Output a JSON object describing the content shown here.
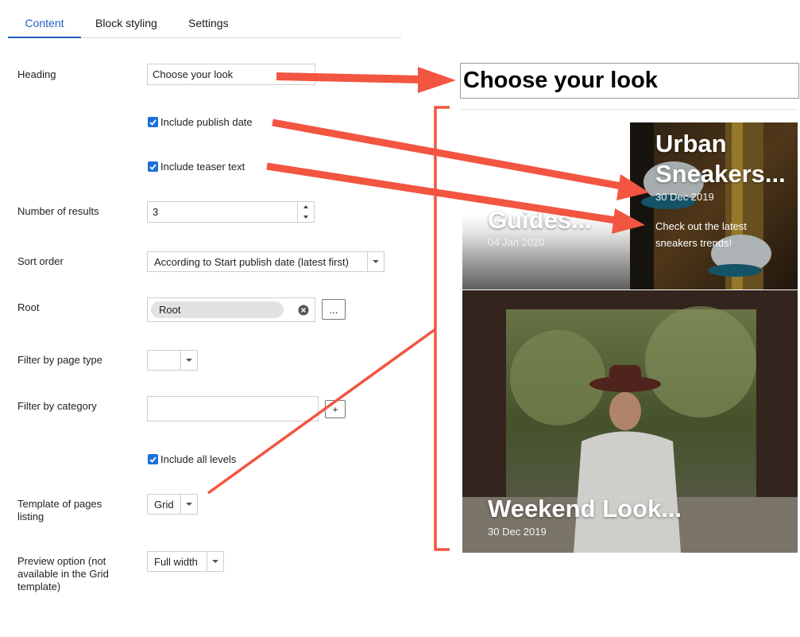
{
  "tabs": [
    "Content",
    "Block styling",
    "Settings"
  ],
  "form": {
    "heading_label": "Heading",
    "heading_value": "Choose your look",
    "include_publish_date": "Include publish date",
    "include_teaser_text": "Include teaser text",
    "number_of_results_label": "Number of results",
    "number_of_results_value": "3",
    "sort_order_label": "Sort order",
    "sort_order_value": "According to Start publish date (latest first)",
    "root_label": "Root",
    "root_value": "Root",
    "root_browse": "...",
    "filter_page_type_label": "Filter by page type",
    "filter_category_label": "Filter by category",
    "add_category": "+",
    "include_all_levels": "Include all levels",
    "template_label_line1": "Template of pages",
    "template_label_line2": "listing",
    "template_value": "Grid",
    "preview_label_line1": "Preview option (not",
    "preview_label_line2": "available in the Grid",
    "preview_label_line3": "template)",
    "preview_value": "Full width"
  },
  "preview": {
    "heading": "Choose your look",
    "cards": [
      {
        "title": "Guides...",
        "date": "04 Jan 2020"
      },
      {
        "title_line1": "Urban",
        "title_line2": "Sneakers...",
        "date": "30 Dec 2019",
        "teaser_line1": "Check out the latest",
        "teaser_line2": "sneakers trends!"
      },
      {
        "title": "Weekend Look...",
        "date": "30 Dec 2019"
      }
    ]
  },
  "colors": {
    "accent": "#1f5fbf",
    "checkbox": "#1e6fd9",
    "arrow": "#f25540"
  }
}
